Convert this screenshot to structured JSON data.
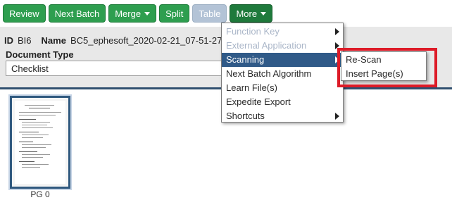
{
  "toolbar": {
    "buttons": [
      {
        "label": "Review"
      },
      {
        "label": "Next Batch"
      },
      {
        "label": "Merge"
      },
      {
        "label": "Split"
      },
      {
        "label": "Table"
      },
      {
        "label": "More"
      }
    ]
  },
  "header": {
    "id_label": "ID",
    "id_value": "BI6",
    "name_label": "Name",
    "name_value": "BC5_ephesoft_2020-02-21_07-51-27",
    "doc_type_label": "Document Type",
    "doc_type_value": "Checklist"
  },
  "thumbnail": {
    "caption": "PG 0"
  },
  "more_menu": {
    "items": [
      {
        "label": "Function Key"
      },
      {
        "label": "External Application"
      },
      {
        "label": "Scanning"
      },
      {
        "label": "Next Batch Algorithm"
      },
      {
        "label": "Learn File(s)"
      },
      {
        "label": "Expedite Export"
      },
      {
        "label": "Shortcuts"
      }
    ]
  },
  "scanning_submenu": {
    "items": [
      {
        "label": "Re-Scan"
      },
      {
        "label": "Insert Page(s)"
      }
    ]
  },
  "colors": {
    "button_green": "#2e9e4f",
    "menu_active": "#305a88",
    "highlight": "#dd1b28"
  }
}
